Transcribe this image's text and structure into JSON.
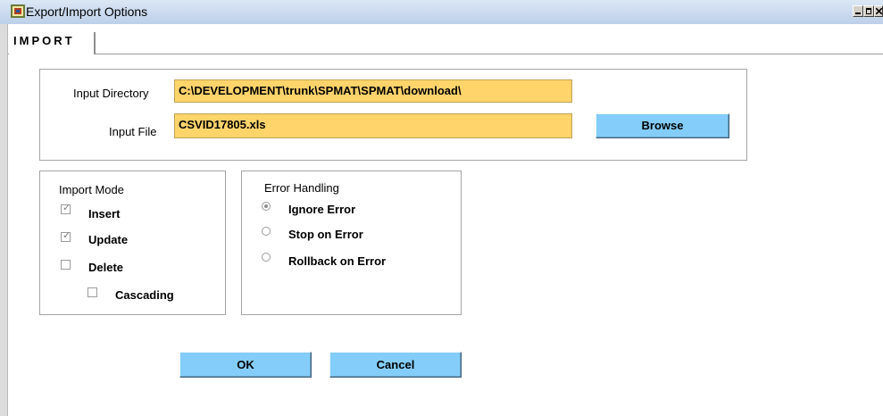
{
  "window": {
    "title": "Export/Import Options",
    "controls": [
      "minimize",
      "maximize",
      "close"
    ]
  },
  "tabs": [
    {
      "label": "IMPORT",
      "active": true
    }
  ],
  "input_section": {
    "directory_label": "Input Directory",
    "directory_value": "C:\\DEVELOPMENT\\trunk\\SPMAT\\SPMAT\\download\\",
    "file_label": "Input File",
    "file_value": "CSVID17805.xls",
    "browse_label": "Browse"
  },
  "import_mode": {
    "title": "Import Mode",
    "options": [
      {
        "label": "Insert",
        "checked": true
      },
      {
        "label": "Update",
        "checked": true
      },
      {
        "label": "Delete",
        "checked": false
      },
      {
        "label": "Cascading",
        "checked": false
      }
    ]
  },
  "error_handling": {
    "title": "Error Handling",
    "options": [
      {
        "label": "Ignore Error",
        "selected": true
      },
      {
        "label": "Stop on Error",
        "selected": false
      },
      {
        "label": "Rollback on Error",
        "selected": false
      }
    ]
  },
  "actions": {
    "ok_label": "OK",
    "cancel_label": "Cancel"
  },
  "colors": {
    "field_bg": "#ffd46b",
    "button_bg": "#84cdfa",
    "titlebar": "#c9d9ee"
  }
}
